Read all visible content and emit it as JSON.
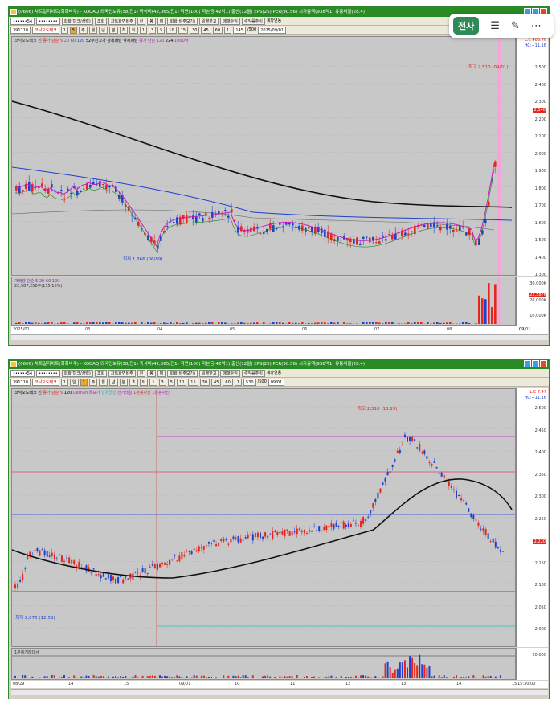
{
  "top": {
    "title": "(0606) 차트일지차트(회화비주) - KODAQ 외국인보유(58/전1) 즉석비(42,065/전1) 적면(100) 자본금(42억1) 출산(12월) EPS(25) PER(90.56) 시가총액(938억1) 유통비율(28.4)",
    "toolbar1": [
      "••••••54",
      "••••••••",
      "회화(마크/상력)",
      "조회",
      "차트화면비주",
      "전",
      "봉",
      "미",
      "회화(비주보기)",
      "일별한고",
      "매매수익",
      "수익률추이",
      "계좌연동"
    ],
    "toolbar2": [
      "391710",
      "코낙오도테크",
      "1",
      "5",
      "주",
      "월",
      "년",
      "분",
      "초",
      "틱",
      "1",
      "3",
      "5",
      "10",
      "15",
      "30",
      "45",
      "60",
      "1",
      "145",
      "/500",
      "2025/09/01"
    ],
    "legend": [
      "코낙오도테크 선",
      "종가 단순 5",
      "20",
      "60",
      "120",
      "52주신고가",
      "강세패턴",
      "약세패턴",
      "종가 단순 120",
      "224",
      "1000억"
    ],
    "yticks": [
      "2,500",
      "2,400",
      "2,300",
      "2,200",
      "2,100",
      "2,000",
      "1,900",
      "1,800",
      "1,700",
      "1,600",
      "1,500",
      "1,400",
      "1,300"
    ],
    "price_tag_top": "L:C 403.76",
    "price_tag_hc": "HC:+11.16",
    "price_tag_now": "2,140",
    "high_label": "최고 2,510 (09/01)",
    "low_label": "최저 1,366 (06/09)",
    "vol_legend": "거래량  단순 5  20  60  120",
    "vol_value": "22,587,250주(115.16%)",
    "vol_yticks": [
      "30,000K",
      "20,000K",
      "10,000K"
    ],
    "vol_tag": "22,587K",
    "xlabels": [
      "2025/01",
      "03",
      "04",
      "05",
      "06",
      "07",
      "08",
      "09"
    ],
    "xend": "09/01"
  },
  "bottom": {
    "title": "(0606) 차트일지차트(회화비주) - KODAQ 외국인보유(58/전1) 즉석비(42,065/전1) 적면(100) 자본금(42억1) 출산(12월) EPS(25) PER(90.56) 시가총액(938억1) 유통비율(28.4)",
    "toolbar1": [
      "••••••54",
      "••••••••",
      "회화(마크/상력)",
      "조회",
      "차트화면비주",
      "전",
      "봉",
      "미",
      "회화(비주보기)",
      "일별한고",
      "매매수익",
      "수익률추이",
      "계좌연동"
    ],
    "toolbar2": [
      "391710",
      "코낙오도테크",
      "1",
      "일",
      "1",
      "주",
      "월",
      "년",
      "분",
      "초",
      "틱",
      "1",
      "3",
      "5",
      "10",
      "15",
      "30",
      "45",
      "60",
      "1",
      "530",
      "/500",
      "09/01"
    ],
    "legend": [
      "코낙오도테크 선",
      "종가 단순 5",
      "120",
      "Demark목표가",
      "일목균형",
      "전거래일",
      "1분봉자선",
      "1분봉자선"
    ],
    "yticks": [
      "2,500",
      "2,450",
      "2,400",
      "2,350",
      "2,300",
      "2,250",
      "2,200",
      "2,150",
      "2,100",
      "2,050",
      "2,000"
    ],
    "price_tag_top": "L:C 7.47",
    "price_tag_hc": "HC:+11.16",
    "price_tag_now": "2,220",
    "high_label": "최고 2,510 (13:19)",
    "low_label": "최저 2,075 (12:53)",
    "vol_legend": "1분봉거래대금",
    "vol_ytick": "20,000",
    "xlabels": [
      "08/29",
      "14",
      "15",
      "09/01",
      "10",
      "11",
      "12",
      "13",
      "14",
      "15"
    ],
    "xend": "15:30:00"
  },
  "overlay": {
    "badge": "전사",
    "menu_icon": "list-icon",
    "edit_icon": "pencil-icon",
    "more_icon": "more-icon"
  },
  "colors": {
    "up": "#e8241c",
    "down": "#1f3fd0",
    "ma_black": "#111111",
    "ma_magenta": "#c020c0",
    "ma_blue": "#1f3fd0",
    "highlight": "#ff9de0"
  }
}
